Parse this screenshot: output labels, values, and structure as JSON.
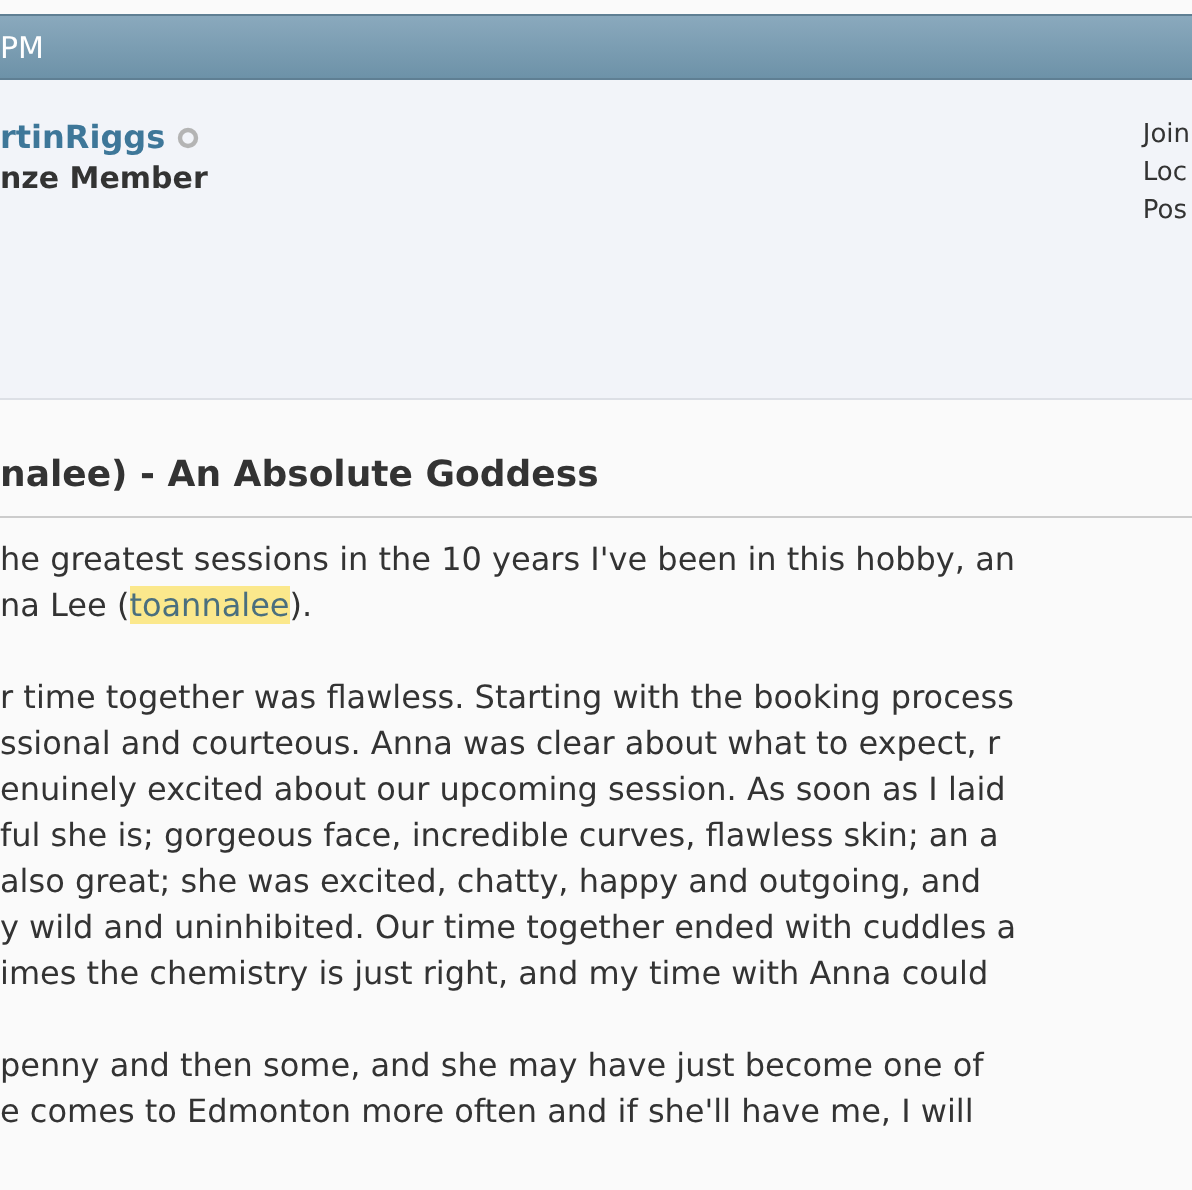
{
  "header": {
    "title": "PM"
  },
  "profile": {
    "username": "rtinRiggs",
    "online": false,
    "rank": "nze Member",
    "details": [
      "Join",
      "Loc",
      "Pos"
    ]
  },
  "post": {
    "title": "nalee) - An Absolute Goddess",
    "paragraphs": [
      {
        "lines": [
          {
            "text": "he greatest sessions in the 10 years I've been in this hobby, an"
          },
          {
            "text": "na Lee (",
            "link": "toannalee",
            "after": ")."
          }
        ]
      },
      {
        "lines": [
          {
            "text": "r time together was flawless. Starting with the booking process"
          },
          {
            "text": "ssional and courteous. Anna was clear about what to expect, r"
          },
          {
            "text": "enuinely excited about our upcoming session. As soon as I laid"
          },
          {
            "text": "ful she is; gorgeous face, incredible curves, flawless skin; an a"
          },
          {
            "text": "also great; she was excited, chatty, happy and outgoing, and"
          },
          {
            "text": "y wild and uninhibited. Our time together ended with cuddles a"
          },
          {
            "text": "imes the chemistry is just right, and my time with Anna could"
          }
        ]
      },
      {
        "lines": [
          {
            "text": "penny and then some, and she may have just become one of"
          },
          {
            "text": "e comes to Edmonton more often and if she'll have me, I will"
          }
        ]
      }
    ]
  }
}
